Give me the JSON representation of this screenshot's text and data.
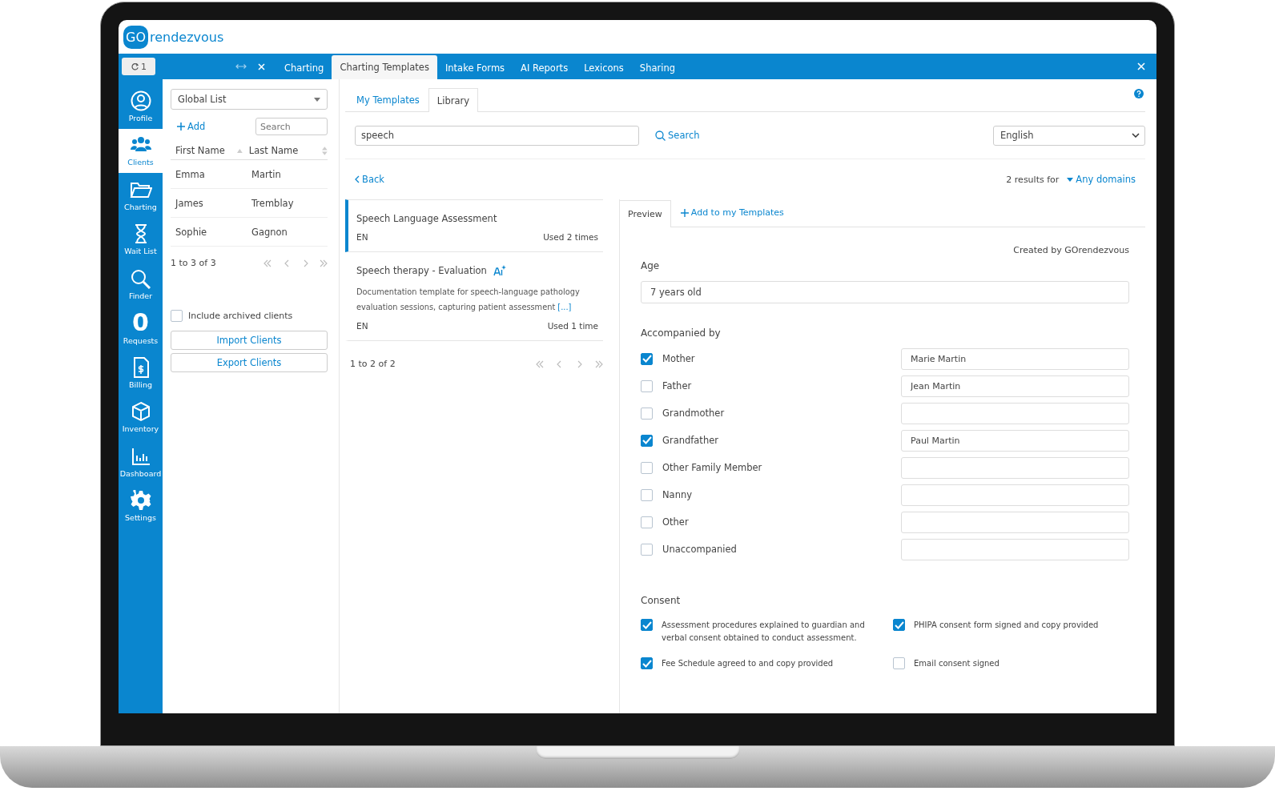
{
  "header": {
    "logo_mark": "GO",
    "logo_text": "rendezvous"
  },
  "tab_bar": {
    "counter": "1",
    "tabs": [
      {
        "label": "Charting",
        "selected": false
      },
      {
        "label": "Charting Templates",
        "selected": true
      },
      {
        "label": "Intake Forms",
        "selected": false
      },
      {
        "label": "AI Reports",
        "selected": false
      },
      {
        "label": "Lexicons",
        "selected": false
      },
      {
        "label": "Sharing",
        "selected": false
      }
    ]
  },
  "sidebar": {
    "items": [
      {
        "kind": "profile",
        "label": "Profile",
        "selected": false
      },
      {
        "kind": "clients",
        "label": "Clients",
        "selected": true
      },
      {
        "kind": "charting",
        "label": "Charting",
        "selected": false
      },
      {
        "kind": "waitlist",
        "label": "Wait List",
        "selected": false
      },
      {
        "kind": "finder",
        "label": "Finder",
        "selected": false
      },
      {
        "kind": "count",
        "count": "0",
        "label": "Requests",
        "selected": false
      },
      {
        "kind": "billing",
        "label": "Billing",
        "selected": false
      },
      {
        "kind": "inventory",
        "label": "Inventory",
        "selected": false
      },
      {
        "kind": "dashboard",
        "label": "Dashboard",
        "selected": false
      },
      {
        "kind": "settings",
        "label": "Settings",
        "selected": false
      }
    ]
  },
  "clients": {
    "list": "Global List",
    "add": "Add",
    "search_placeholder": "Search",
    "columns": [
      "First Name",
      "Last Name"
    ],
    "rows": [
      {
        "first": "Emma",
        "last": "Martin"
      },
      {
        "first": "James",
        "last": "Tremblay"
      },
      {
        "first": "Sophie",
        "last": "Gagnon"
      }
    ],
    "pagination": "1 to 3 of 3",
    "archived": {
      "label": "Include archived clients",
      "checked": false
    },
    "buttons": [
      "Import Clients",
      "Export Clients"
    ]
  },
  "templates": {
    "tabs": [
      {
        "label": "My Templates",
        "selected": false
      },
      {
        "label": "Library",
        "selected": true
      }
    ],
    "search_value": "speech",
    "search_button": "Search",
    "language": "English",
    "back": "Back",
    "results_text": "2 results for",
    "domains": "Any domains",
    "items": [
      {
        "title": "Speech Language Assessment",
        "ai": false,
        "language": "EN",
        "usage": "Used 2 times",
        "selected": true
      },
      {
        "title": "Speech therapy - Evaluation",
        "ai": true,
        "description": "Documentation template for speech-language pathology evaluation sessions, capturing patient assessment",
        "more": "[...]",
        "language": "EN",
        "usage": "Used 1 time",
        "selected": false
      }
    ],
    "pagination": "1 to 2 of 2"
  },
  "preview": {
    "tab": "Preview",
    "add": "Add to my Templates",
    "created_by": "Created by GOrendezvous",
    "age_label": "Age",
    "age_value": "7 years old",
    "accompanied_label": "Accompanied by",
    "accompanied": [
      {
        "label": "Mother",
        "checked": true,
        "value": "Marie Martin"
      },
      {
        "label": "Father",
        "checked": false,
        "value": "Jean Martin"
      },
      {
        "label": "Grandmother",
        "checked": false
      },
      {
        "label": "Grandfather",
        "checked": true,
        "value": "Paul Martin"
      },
      {
        "label": "Other Family Member",
        "checked": false
      },
      {
        "label": "Nanny",
        "checked": false
      },
      {
        "label": "Other",
        "checked": false
      },
      {
        "label": "Unaccompanied",
        "checked": false
      }
    ],
    "consent_label": "Consent",
    "consent": [
      {
        "label": "Assessment procedures explained to guardian and verbal consent obtained to conduct assessment.",
        "checked": true
      },
      {
        "label": "PHIPA consent form signed and copy provided",
        "checked": true
      },
      {
        "label": "Fee Schedule agreed to and copy provided",
        "checked": true
      },
      {
        "label": "Email consent signed",
        "checked": false
      }
    ]
  }
}
